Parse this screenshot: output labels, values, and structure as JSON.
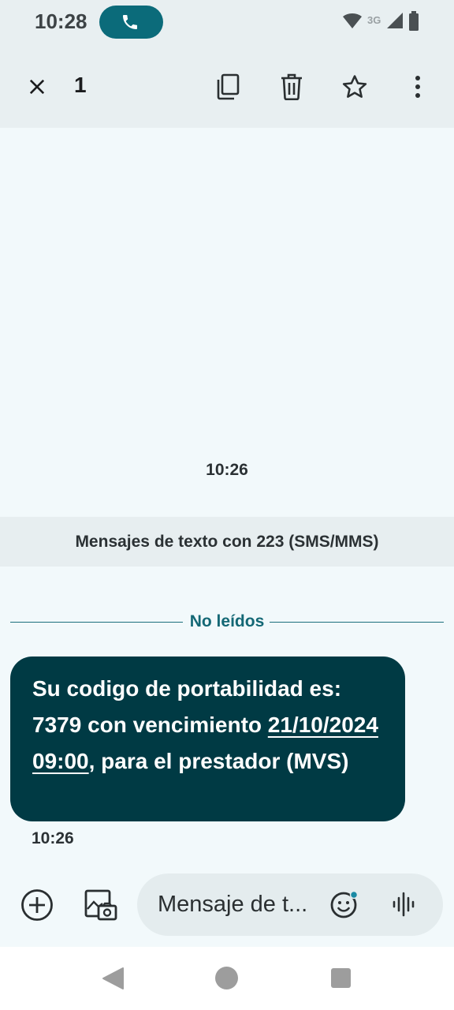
{
  "status_bar": {
    "time": "10:28",
    "network": "3G",
    "icons": [
      "call-active-icon",
      "wifi-icon",
      "signal-icon",
      "battery-icon"
    ]
  },
  "app_bar": {
    "selected_count": "1",
    "actions": [
      "close-icon",
      "copy-icon",
      "delete-icon",
      "star-icon",
      "more-vert-icon"
    ]
  },
  "thread": {
    "header_time": "10:26",
    "conversation_info": "Mensajes de texto con 223 (SMS/MMS)",
    "unread_divider": "No leídos",
    "messages": [
      {
        "text_part1": "Su codigo de portabilidad es: 7379 con vencimiento ",
        "date_link": "21/10/2024 09:00",
        "text_part2": ", para el prestador (MVS)",
        "time": "10:26"
      }
    ]
  },
  "composer": {
    "placeholder": "Mensaje de t..."
  },
  "colors": {
    "accent": "#0b6b7a",
    "bubble": "#003a44",
    "background": "#f2f9fb",
    "app_bar": "#e8eff1"
  }
}
